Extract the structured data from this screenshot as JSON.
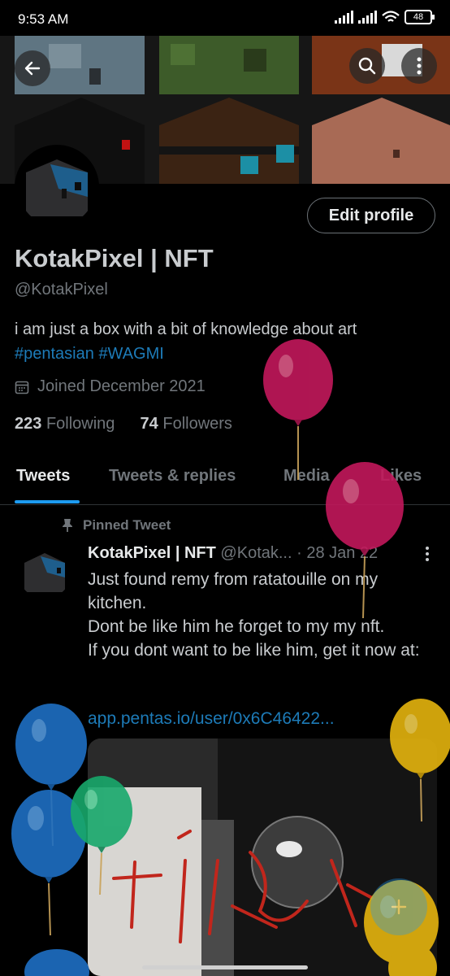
{
  "status_bar": {
    "time": "9:53 AM",
    "battery": "48"
  },
  "profile": {
    "edit_button": "Edit profile",
    "display_name": "KotakPixel | NFT",
    "handle": "@KotakPixel",
    "bio_text": "i am just a box with a bit of knowledge about art",
    "bio_tags": [
      "#pentasian",
      "#WAGMI"
    ],
    "joined": "Joined December 2021",
    "following_count": "223",
    "following_label": "Following",
    "followers_count": "74",
    "followers_label": "Followers"
  },
  "tabs": [
    "Tweets",
    "Tweets & replies",
    "Media",
    "Likes"
  ],
  "pinned_tweet": {
    "label": "Pinned Tweet",
    "author_name": "KotakPixel | NFT",
    "author_handle": "@Kotak...",
    "date": "· 28 Jan 22",
    "lines": [
      "Just found remy from ratatouille on my kitchen.",
      "Dont be like him he forget to my my nft.",
      "If you dont want to be like him, get it now at:"
    ],
    "link": "app.pentas.io/user/0x6C46422..."
  },
  "balloon_colors": {
    "red": "#c2185b",
    "blue": "#1e6fc4",
    "green": "#18a86b",
    "yellow": "#e5b40e"
  }
}
